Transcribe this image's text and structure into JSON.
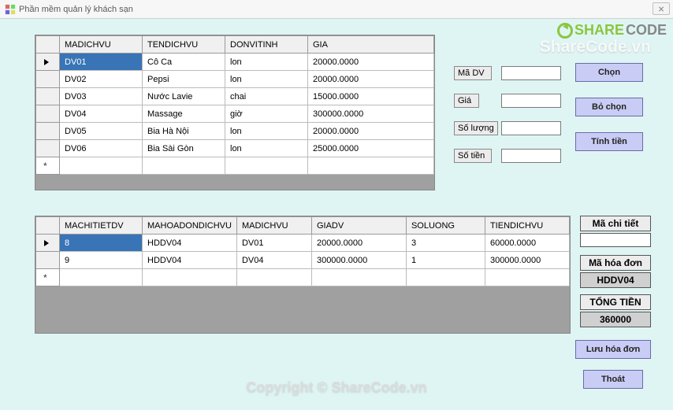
{
  "window": {
    "title": "Phần mềm quản lý khách sạn"
  },
  "watermark": {
    "top": "ShareCode.vn",
    "bottom": "Copyright © ShareCode.vn",
    "logo_share": "SHARE",
    "logo_code": "CODE"
  },
  "grid1": {
    "headers": [
      "MADICHVU",
      "TENDICHVU",
      "DONVITINH",
      "GIA"
    ],
    "rows": [
      {
        "c": [
          "DV01",
          "Cô Ca",
          "lon",
          "20000.0000"
        ],
        "selected": true
      },
      {
        "c": [
          "DV02",
          "Pepsi",
          "lon",
          "20000.0000"
        ]
      },
      {
        "c": [
          "DV03",
          "Nước Lavie",
          "chai",
          "15000.0000"
        ]
      },
      {
        "c": [
          "DV04",
          "Massage",
          "giờ",
          "300000.0000"
        ]
      },
      {
        "c": [
          "DV05",
          "Bia Hà Nội",
          "lon",
          "20000.0000"
        ]
      },
      {
        "c": [
          "DV06",
          "Bia Sài Gòn",
          "lon",
          "25000.0000"
        ]
      }
    ]
  },
  "grid2": {
    "headers": [
      "MACHITIETDV",
      "MAHOADONDICHVU",
      "MADICHVU",
      "GIADV",
      "SOLUONG",
      "TIENDICHVU"
    ],
    "rows": [
      {
        "c": [
          "8",
          "HDDV04",
          "DV01",
          "20000.0000",
          "3",
          "60000.0000"
        ],
        "selected": true
      },
      {
        "c": [
          "9",
          "HDDV04",
          "DV04",
          "300000.0000",
          "1",
          "300000.0000"
        ]
      }
    ]
  },
  "form": {
    "madv_label": "Mã DV",
    "gia_label": "Giá",
    "soluong_label": "Số lượng",
    "sotien_label": "Số tiền",
    "madv_value": "",
    "gia_value": "",
    "soluong_value": "",
    "sotien_value": ""
  },
  "buttons": {
    "chon": "Chọn",
    "bochon": "Bỏ chọn",
    "tinhtien": "Tính tiền",
    "luuhoadon": "Lưu hóa đơn",
    "thoat": "Thoát"
  },
  "summary": {
    "machitiet_label": "Mã chi tiết",
    "machitiet_value": "",
    "mahoadon_label": "Mã hóa đơn",
    "mahoadon_value": "HDDV04",
    "tongtien_label": "TỔNG TIỀN",
    "tongtien_value": "360000"
  }
}
